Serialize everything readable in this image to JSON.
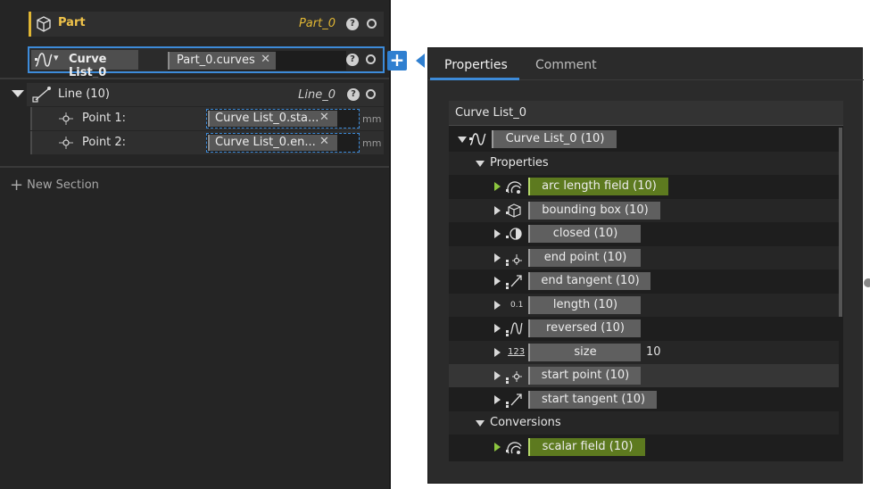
{
  "left_panel": {
    "part_row": {
      "label": "Part",
      "output": "Part_0",
      "help": "?"
    },
    "curve_list_row": {
      "label": "Curve List_0",
      "input_tag": "Part_0.curves",
      "remove": "✕",
      "help": "?"
    },
    "line_row": {
      "label": "Line (10)",
      "output": "Line_0",
      "help": "?"
    },
    "points": [
      {
        "label": "Point 1:",
        "value": "Curve List_0.sta...",
        "remove": "✕",
        "unit": "mm"
      },
      {
        "label": "Point 2:",
        "value": "Curve List_0.en...",
        "remove": "✕",
        "unit": "mm"
      }
    ],
    "new_section": "New Section"
  },
  "add_button": {
    "label": "+"
  },
  "popup": {
    "tabs": [
      {
        "label": "Properties",
        "active": true
      },
      {
        "label": "Comment",
        "active": false
      }
    ],
    "title": "Curve List_0",
    "root": {
      "label": "Curve List_0 (10)"
    },
    "sections": [
      {
        "label": "Properties",
        "items": [
          {
            "label": "arc length field (10)",
            "icon": "arc-length-field-icon",
            "highlight": "green"
          },
          {
            "label": "bounding box (10)",
            "icon": "bounding-box-icon"
          },
          {
            "label": "closed (10)",
            "icon": "closed-icon"
          },
          {
            "label": "end point (10)",
            "icon": "end-point-icon"
          },
          {
            "label": "end tangent (10)",
            "icon": "end-tangent-icon"
          },
          {
            "label": "length (10)",
            "icon": "length-icon"
          },
          {
            "label": "reversed (10)",
            "icon": "reversed-icon"
          },
          {
            "label": "size",
            "icon": "size-icon",
            "value": "10"
          },
          {
            "label": "start point (10)",
            "icon": "start-point-icon"
          },
          {
            "label": "start tangent (10)",
            "icon": "start-tangent-icon"
          }
        ]
      },
      {
        "label": "Conversions",
        "items": [
          {
            "label": "scalar field (10)",
            "icon": "scalar-field-icon",
            "highlight": "green"
          }
        ]
      }
    ],
    "size_icon_text": "123",
    "length_icon_text": "0.1"
  },
  "colors": {
    "accent": "#3d8bd9",
    "part": "#e0b634",
    "green": "#5d7a1f"
  }
}
